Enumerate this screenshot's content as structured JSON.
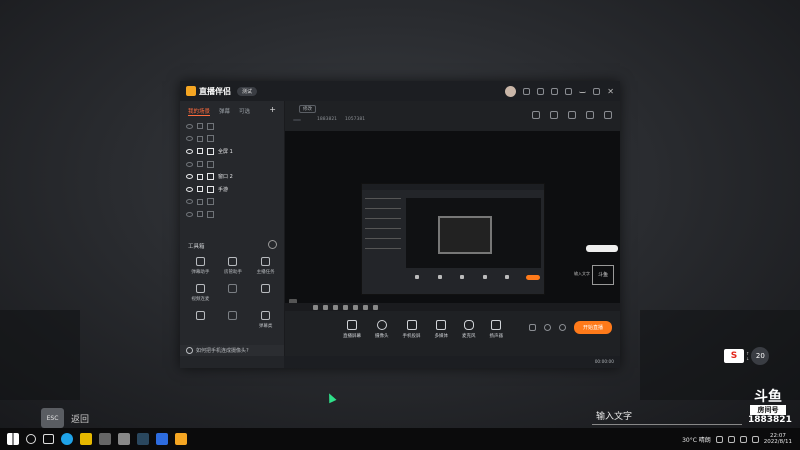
{
  "app": {
    "name": "直播伴侣",
    "version_badge": "测试",
    "left_tabs": [
      "我的场景",
      "弹幕",
      "可选"
    ],
    "scenes": [
      {
        "label": "",
        "visible": false
      },
      {
        "label": "",
        "visible": false
      },
      {
        "label": "全屏 1",
        "visible": true
      },
      {
        "label": "",
        "visible": false
      },
      {
        "label": "窗口 2",
        "visible": true
      },
      {
        "label": "手游",
        "visible": true
      },
      {
        "label": "",
        "visible": false
      },
      {
        "label": "",
        "visible": false
      }
    ],
    "tools_title": "工具箱",
    "tools": [
      {
        "label": "弹幕助手",
        "dim": false
      },
      {
        "label": "房管助手",
        "dim": false
      },
      {
        "label": "主播任务",
        "dim": false
      },
      {
        "label": "视频连麦",
        "dim": false
      },
      {
        "label": "",
        "dim": true
      },
      {
        "label": "",
        "dim": false
      },
      {
        "label": "",
        "dim": false
      },
      {
        "label": "",
        "dim": true
      },
      {
        "label": "弹幕类",
        "dim": false
      }
    ],
    "hint_text": "如何把手机连成摄像头?",
    "room": {
      "title": "",
      "tag": "修改",
      "category": "",
      "room_label": "",
      "room_id": "1883821",
      "fans": "1057381"
    },
    "controls": [
      "直播屏幕",
      "摄像头",
      "手机投屏",
      "多媒体",
      "麦克风",
      "扬声器"
    ],
    "go_live_label": "开始直播",
    "status": {
      "item1": "",
      "item2": "",
      "item3": "",
      "item4": "",
      "timer": "00:00:00"
    }
  },
  "overlay": {
    "esc_label": "ESC",
    "back_label": "返回",
    "input_placeholder": "输入文字",
    "brand_big": "斗鱼",
    "brand_sub": "房间号",
    "room_number": "1883821",
    "cpu_label": "20"
  },
  "taskbar": {
    "weather": "30°C 晴朗",
    "time": "22:07",
    "date": "2022/8/11"
  }
}
